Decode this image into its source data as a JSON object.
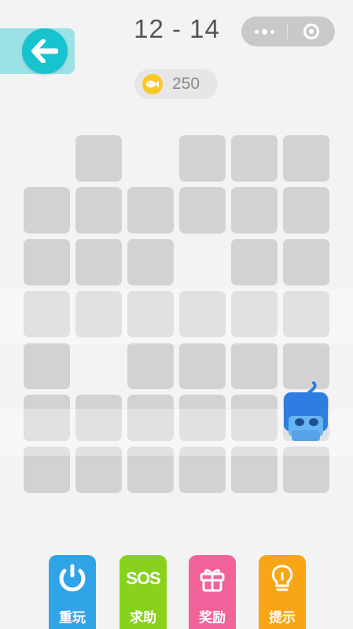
{
  "header": {
    "back_icon": "arrow-left-icon",
    "level": "12 - 14",
    "capsule": {
      "more_icon": "more-dots-icon",
      "close_icon": "target-circle-icon"
    }
  },
  "coins": {
    "icon": "fish-coin-icon",
    "count": "250"
  },
  "board": {
    "rows": 7,
    "cols": 6,
    "tiles": [
      [
        0,
        1,
        0,
        1,
        1,
        1
      ],
      [
        1,
        1,
        1,
        1,
        1,
        1
      ],
      [
        1,
        1,
        1,
        0,
        1,
        1
      ],
      [
        1,
        1,
        1,
        1,
        1,
        1
      ],
      [
        1,
        0,
        1,
        1,
        1,
        1
      ],
      [
        1,
        1,
        1,
        1,
        1,
        1
      ],
      [
        1,
        1,
        1,
        1,
        1,
        1
      ]
    ],
    "character": {
      "name": "blue-cat",
      "row": 5,
      "col": 5,
      "color": "#2e7de0"
    }
  },
  "toolbar": {
    "replay": {
      "label": "重玩",
      "icon": "replay-icon",
      "color": "#2fa4e7"
    },
    "sos": {
      "label": "求助",
      "icon_text": "SOS",
      "color": "#88d21c"
    },
    "reward": {
      "label": "奖励",
      "icon": "gift-icon",
      "color": "#f1639a"
    },
    "hint": {
      "label": "提示",
      "icon": "lightbulb-icon",
      "color": "#f8a516"
    }
  }
}
